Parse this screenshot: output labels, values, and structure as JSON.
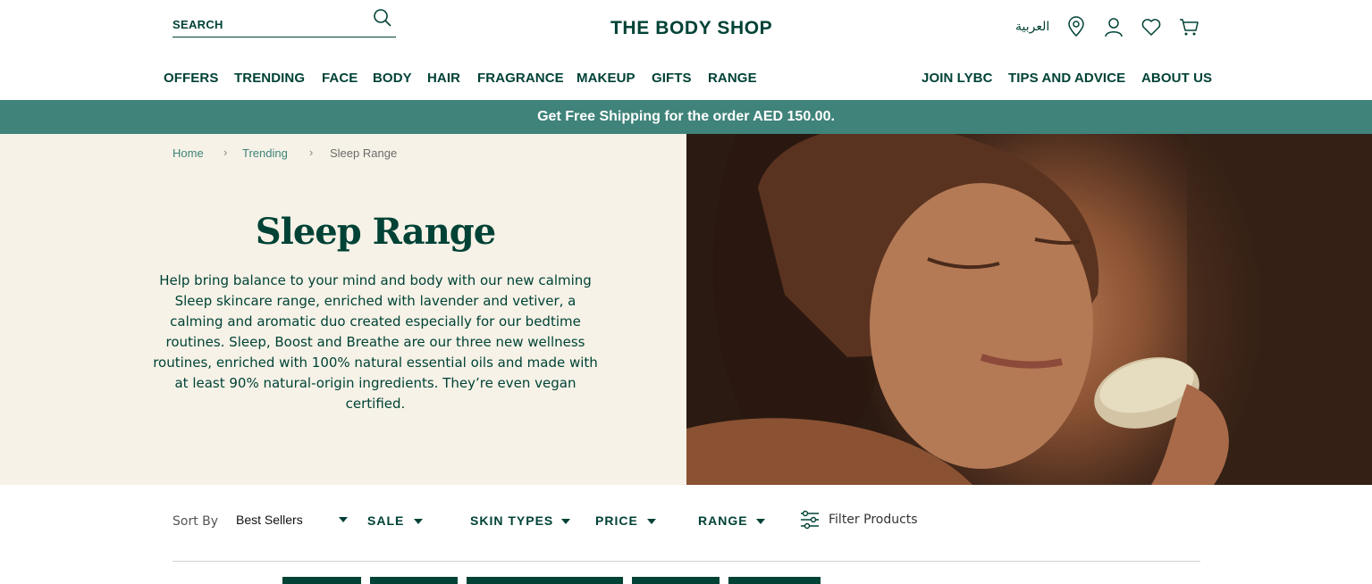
{
  "header": {
    "search_placeholder": "SEARCH",
    "logo": "THE BODY SHOP",
    "language_label": "العربية",
    "icons": [
      "store-locator-icon",
      "account-icon",
      "wishlist-icon",
      "cart-icon"
    ]
  },
  "nav": {
    "left": [
      "OFFERS",
      "TRENDING",
      "FACE",
      "BODY",
      "HAIR",
      "FRAGRANCE",
      "MAKEUP",
      "GIFTS",
      "RANGE"
    ],
    "right": [
      "JOIN LYBC",
      "TIPS AND ADVICE",
      "ABOUT US"
    ]
  },
  "promo": "Get Free Shipping for the order AED 150.00.",
  "breadcrumb": [
    "Home",
    "Trending",
    "Sleep Range"
  ],
  "hero": {
    "title": "Sleep Range",
    "description": "Help bring balance to your mind and body with our new calming Sleep skincare range, enriched with lavender and vetiver, a calming and aromatic duo created especially for our bedtime routines. Sleep, Boost and Breathe are our three new wellness routines, enriched with 100% natural essential oils and made with at least 90% natural-origin ingredients. They’re even vegan certified."
  },
  "filters": {
    "sort_label": "Sort By",
    "sort_value": "Best Sellers",
    "buttons": [
      "SALE",
      "SKIN TYPES",
      "PRICE",
      "RANGE"
    ],
    "filter_products": "Filter Products"
  },
  "colors": {
    "brand_green": "#004236",
    "promo_teal": "#3f837a",
    "hero_cream": "#f6f2e7"
  }
}
